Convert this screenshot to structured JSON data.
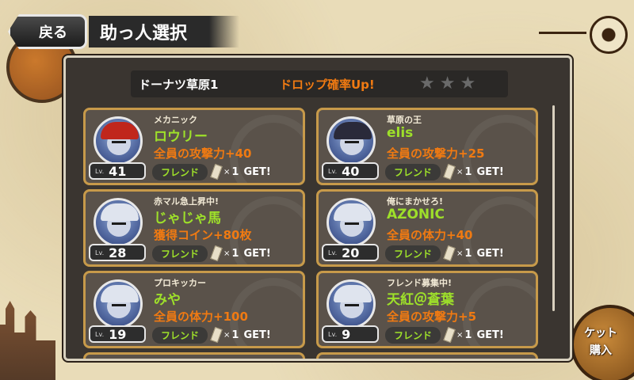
{
  "header": {
    "back_label": "戻る",
    "title": "助っ人選択"
  },
  "stage": {
    "name": "ドーナツ草原1",
    "bonus": "ドロップ確率Up!",
    "stars_filled": 0,
    "stars_total": 3
  },
  "side": {
    "ticket_label_line1": "ケット",
    "ticket_label_line2": "購入"
  },
  "cards": [
    {
      "title": "メカニック",
      "name": "ロウリー",
      "skill": "全員の攻撃力+40",
      "lv_label": "Lv.",
      "level": "41",
      "friend": "フレンド",
      "times": "×",
      "count": "1",
      "get": "GET!",
      "avatar": "red"
    },
    {
      "title": "草原の王",
      "name": "elis",
      "skill": "全員の攻撃力+25",
      "lv_label": "Lv.",
      "level": "40",
      "friend": "フレンド",
      "times": "×",
      "count": "1",
      "get": "GET!",
      "avatar": "dark"
    },
    {
      "title": "赤マル急上昇中!",
      "name": "じゃじゃ馬",
      "skill": "獲得コイン+80枚",
      "lv_label": "Lv.",
      "level": "28",
      "friend": "フレンド",
      "times": "×",
      "count": "1",
      "get": "GET!",
      "avatar": "robot"
    },
    {
      "title": "俺にまかせろ!",
      "name": "AZONIC",
      "skill": "全員の体力+40",
      "lv_label": "Lv.",
      "level": "20",
      "friend": "フレンド",
      "times": "×",
      "count": "1",
      "get": "GET!",
      "avatar": "robot"
    },
    {
      "title": "プロキッカー",
      "name": "みや",
      "skill": "全員の体力+100",
      "lv_label": "Lv.",
      "level": "19",
      "friend": "フレンド",
      "times": "×",
      "count": "1",
      "get": "GET!",
      "avatar": "robot"
    },
    {
      "title": "フレンド募集中!",
      "name": "天紅＠蒼葉",
      "skill": "全員の攻撃力+5",
      "lv_label": "Lv.",
      "level": "9",
      "friend": "フレンド",
      "times": "×",
      "count": "1",
      "get": "GET!",
      "avatar": "robot"
    }
  ]
}
